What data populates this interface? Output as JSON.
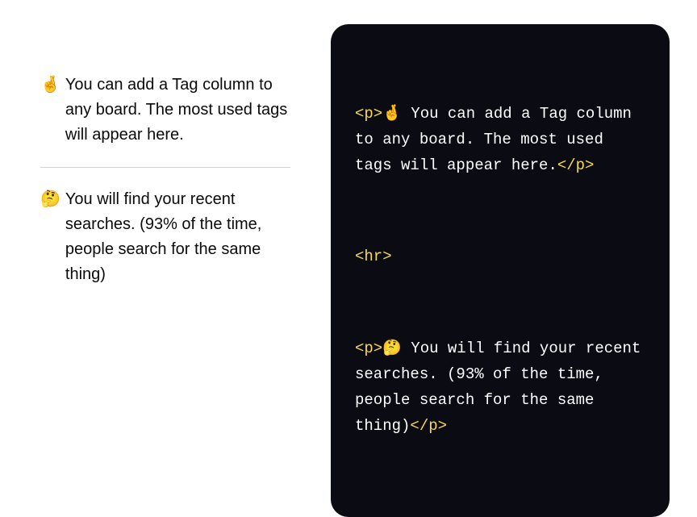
{
  "rendered": {
    "para1": {
      "emoji": "🤞",
      "text": "You can add a Tag column to any board. The most used tags will appear here."
    },
    "para2": {
      "emoji": "🤔",
      "text": "You will find your recent searches. (93% of the time, people search for the same thing)"
    }
  },
  "code": {
    "p_open": "<p>",
    "p_close": "</p>",
    "hr_tag": "<hr>",
    "line1_emoji": "🤞",
    "line1_text": " You can add a Tag column to any board. The most used tags will appear here.",
    "line2_emoji": "🤔",
    "line2_text": " You will find your recent searches. (93% of the time, people search for the same thing)"
  }
}
